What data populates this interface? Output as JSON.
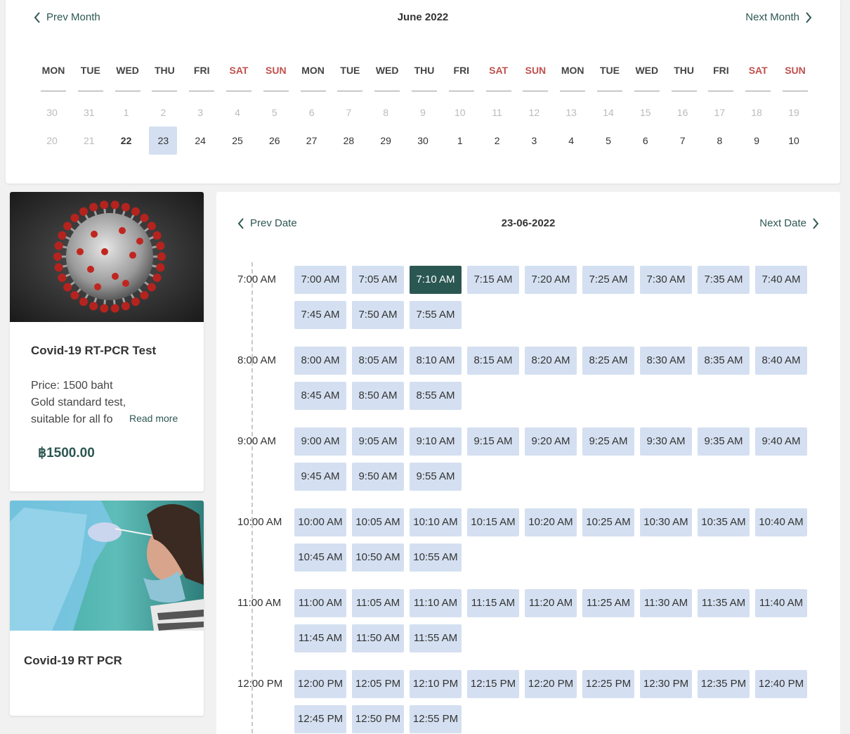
{
  "calendar": {
    "prev_label": "Prev Month",
    "next_label": "Next Month",
    "month_title": "June 2022",
    "weekdays": [
      "MON",
      "TUE",
      "WED",
      "THU",
      "FRI",
      "SAT",
      "SUN",
      "MON",
      "TUE",
      "WED",
      "THU",
      "FRI",
      "SAT",
      "SUN",
      "MON",
      "TUE",
      "WED",
      "THU",
      "FRI",
      "SAT",
      "SUN"
    ],
    "row1": [
      "30",
      "31",
      "1",
      "2",
      "3",
      "4",
      "5",
      "6",
      "7",
      "8",
      "9",
      "10",
      "11",
      "12",
      "13",
      "14",
      "15",
      "16",
      "17",
      "18",
      "19"
    ],
    "row2": [
      "20",
      "21",
      "22",
      "23",
      "24",
      "25",
      "26",
      "27",
      "28",
      "29",
      "30",
      "1",
      "2",
      "3",
      "4",
      "5",
      "6",
      "7",
      "8",
      "9",
      "10"
    ],
    "today": "22",
    "selected": "23",
    "weekend_color": "#c0504d",
    "selected_bg": "#d4e0f1"
  },
  "services": [
    {
      "title": "Covid-19 RT-PCR Test",
      "desc_line1": "Price: 1500 baht",
      "desc_line2": "Gold standard test,",
      "desc_line3": "suitable for all fo",
      "read_more": "Read more",
      "price": "฿1500.00"
    },
    {
      "title": "Covid-19 RT PCR"
    }
  ],
  "slots": {
    "prev_label": "Prev Date",
    "next_label": "Next Date",
    "date_title": "23-06-2022",
    "selected": "7:10 AM",
    "accent": "#2b5753",
    "groups": [
      {
        "hour": "7:00 AM",
        "times": [
          "7:00 AM",
          "7:05 AM",
          "7:10 AM",
          "7:15 AM",
          "7:20 AM",
          "7:25 AM",
          "7:30 AM",
          "7:35 AM",
          "7:40 AM",
          "7:45 AM",
          "7:50 AM",
          "7:55 AM"
        ]
      },
      {
        "hour": "8:00 AM",
        "times": [
          "8:00 AM",
          "8:05 AM",
          "8:10 AM",
          "8:15 AM",
          "8:20 AM",
          "8:25 AM",
          "8:30 AM",
          "8:35 AM",
          "8:40 AM",
          "8:45 AM",
          "8:50 AM",
          "8:55 AM"
        ]
      },
      {
        "hour": "9:00 AM",
        "times": [
          "9:00 AM",
          "9:05 AM",
          "9:10 AM",
          "9:15 AM",
          "9:20 AM",
          "9:25 AM",
          "9:30 AM",
          "9:35 AM",
          "9:40 AM",
          "9:45 AM",
          "9:50 AM",
          "9:55 AM"
        ]
      },
      {
        "hour": "10:00 AM",
        "times": [
          "10:00 AM",
          "10:05 AM",
          "10:10 AM",
          "10:15 AM",
          "10:20 AM",
          "10:25 AM",
          "10:30 AM",
          "10:35 AM",
          "10:40 AM",
          "10:45 AM",
          "10:50 AM",
          "10:55 AM"
        ]
      },
      {
        "hour": "11:00 AM",
        "times": [
          "11:00 AM",
          "11:05 AM",
          "11:10 AM",
          "11:15 AM",
          "11:20 AM",
          "11:25 AM",
          "11:30 AM",
          "11:35 AM",
          "11:40 AM",
          "11:45 AM",
          "11:50 AM",
          "11:55 AM"
        ]
      },
      {
        "hour": "12:00 PM",
        "times": [
          "12:00 PM",
          "12:05 PM",
          "12:10 PM",
          "12:15 PM",
          "12:20 PM",
          "12:25 PM",
          "12:30 PM",
          "12:35 PM",
          "12:40 PM",
          "12:45 PM",
          "12:50 PM",
          "12:55 PM"
        ]
      }
    ]
  }
}
